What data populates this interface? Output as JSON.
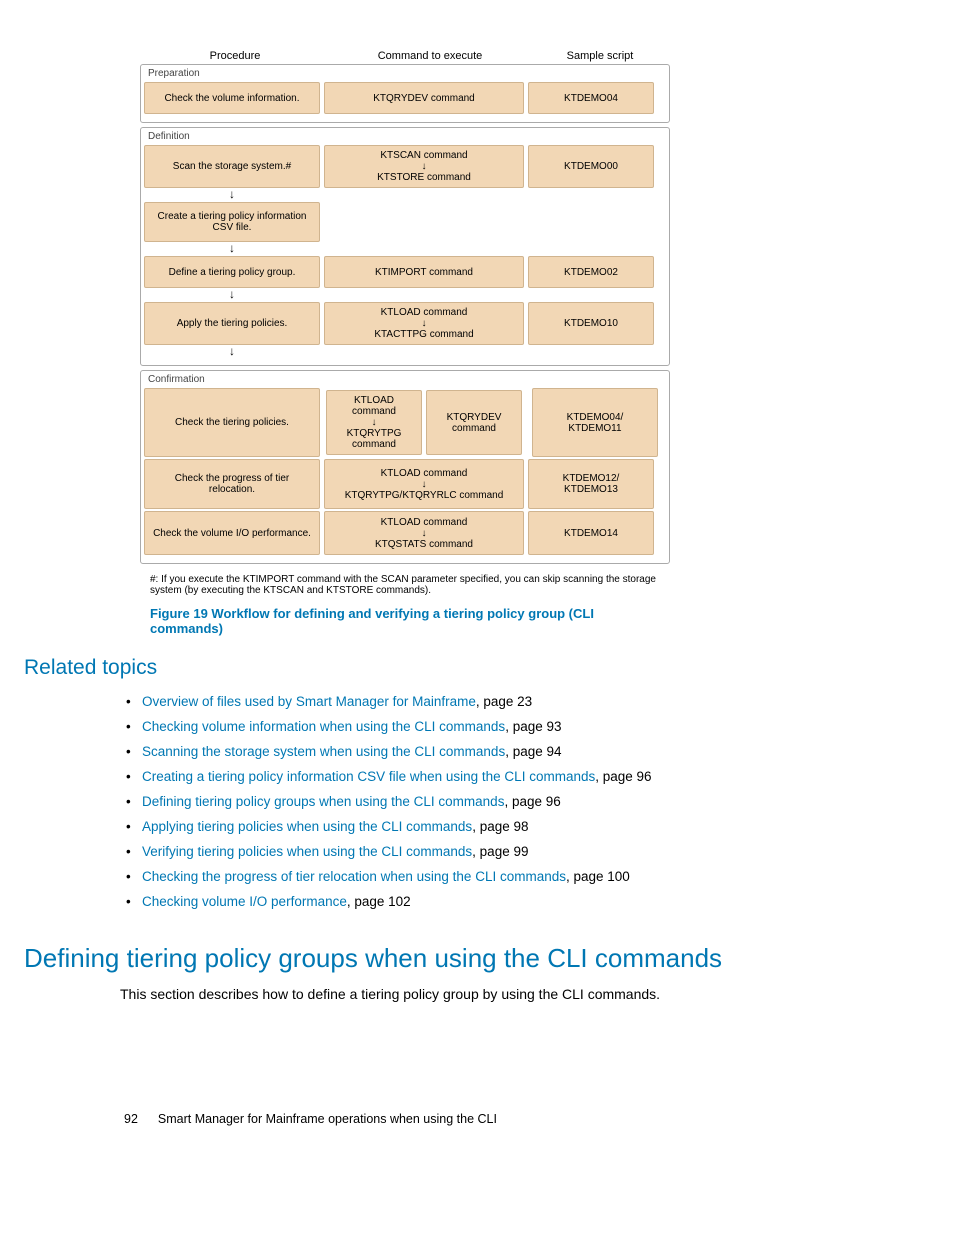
{
  "diagram": {
    "headers": {
      "proc": "Procedure",
      "cmd": "Command to execute",
      "samp": "Sample script"
    },
    "prep": {
      "label": "Preparation",
      "r1": {
        "proc": "Check the volume information.",
        "cmd": "KTQRYDEV command",
        "samp": "KTDEMO04"
      }
    },
    "def": {
      "label": "Definition",
      "r1": {
        "proc": "Scan the storage system.#",
        "cmd_a": "KTSCAN command",
        "cmd_b": "KTSTORE command",
        "samp": "KTDEMO00"
      },
      "r2": {
        "proc": "Create a tiering policy information CSV file."
      },
      "r3": {
        "proc": "Define a tiering policy group.",
        "cmd": "KTIMPORT command",
        "samp": "KTDEMO02"
      },
      "r4": {
        "proc": "Apply the tiering policies.",
        "cmd_a": "KTLOAD command",
        "cmd_b": "KTACTTPG command",
        "samp": "KTDEMO10"
      }
    },
    "conf": {
      "label": "Confirmation",
      "r1": {
        "proc": "Check the tiering policies.",
        "cmd_a": "KTLOAD command",
        "cmd_b": "KTQRYTPG command",
        "cmd_c": "KTQRYDEV command",
        "samp": "KTDEMO04/ KTDEMO11"
      },
      "r2": {
        "proc": "Check the progress of tier relocation.",
        "cmd_a": "KTLOAD command",
        "cmd_b": "KTQRYTPG/KTQRYRLC command",
        "samp": "KTDEMO12/ KTDEMO13"
      },
      "r3": {
        "proc": "Check the volume I/O performance.",
        "cmd_a": "KTLOAD command",
        "cmd_b": "KTQSTATS command",
        "samp": "KTDEMO14"
      }
    },
    "footnote": "#: If you execute the KTIMPORT command with the SCAN parameter specified, you can skip scanning the storage system (by executing the KTSCAN and KTSTORE commands).",
    "caption": "Figure 19 Workflow for defining and verifying a tiering policy group (CLI commands)"
  },
  "related": {
    "heading": "Related topics",
    "items": [
      {
        "link": "Overview of files used by Smart Manager for Mainframe",
        "page": ", page 23"
      },
      {
        "link": "Checking volume information when using the CLI commands",
        "page": ", page 93"
      },
      {
        "link": "Scanning the storage system when using the CLI commands",
        "page": ", page 94"
      },
      {
        "link": "Creating a tiering policy information CSV file when using the CLI commands",
        "page": ", page 96"
      },
      {
        "link": "Defining tiering policy groups when using the CLI commands",
        "page": ", page 96"
      },
      {
        "link": "Applying tiering policies when using the CLI commands",
        "page": ", page 98"
      },
      {
        "link": "Verifying tiering policies when using the CLI commands",
        "page": ", page 99"
      },
      {
        "link": "Checking the progress of tier relocation when using the CLI commands",
        "page": ", page 100"
      },
      {
        "link": "Checking volume I/O performance",
        "page": ", page 102"
      }
    ]
  },
  "section": {
    "heading": "Defining tiering policy groups when using the CLI commands",
    "para": "This section describes how to define a tiering policy group by using the CLI commands."
  },
  "footer": {
    "page": "92",
    "title": "Smart Manager for Mainframe operations when using the CLI"
  }
}
